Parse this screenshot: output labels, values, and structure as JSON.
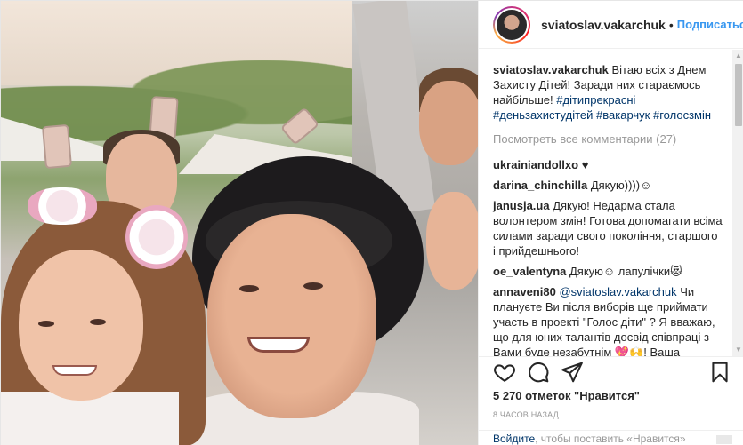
{
  "header": {
    "username": "sviatoslav.vakarchuk",
    "separator": "•",
    "follow_label": "Подписаться"
  },
  "caption": {
    "username": "sviatoslav.vakarchuk",
    "text": "Вітаю всіх з Днем Захисту Дітей! Заради них стараємось найбільше!",
    "hashtags": [
      "#дітипрекрасні",
      "#деньзахистудітей",
      "#вакарчук",
      "#голосзмін"
    ]
  },
  "view_all_comments": "Посмотреть все комментарии (27)",
  "comments": [
    {
      "username": "ukrainiandollxo",
      "text": "♥"
    },
    {
      "username": "darina_chinchilla",
      "text": "Дякую))))☺"
    },
    {
      "username": "janusja.ua",
      "text": "Дякую! Недарма стала волонтером змін! Готова допомагати всіма силами заради свого покоління, старшого і прийдешнього!"
    },
    {
      "username": "oe_valentyna",
      "text": "Дякую☺ лапулічки😻"
    },
    {
      "username": "annaveni80",
      "mention": "@sviatoslav.vakarchuk",
      "text": "Чи плануєте Ви після виборів ще приймати участь в проекті \"Голос діти\" ? Я вважаю, що для юних талантів досвід співпраці з Вами буде незабутнім 💖🙌! Ваша творчість - душа і Голос України!"
    }
  ],
  "likes_text": "5 270 отметок \"Нравится\"",
  "time_ago": "8 ЧАСОВ НАЗАД",
  "login_prompt": {
    "link": "Войдите",
    "text": ", чтобы поставить «Нравится»"
  },
  "icons": {
    "like": "heart-icon",
    "comment": "comment-bubble-icon",
    "share": "share-paper-plane-icon",
    "save": "bookmark-icon"
  },
  "colors": {
    "follow": "#3897f0",
    "hashtag": "#003569",
    "muted": "#999999"
  }
}
